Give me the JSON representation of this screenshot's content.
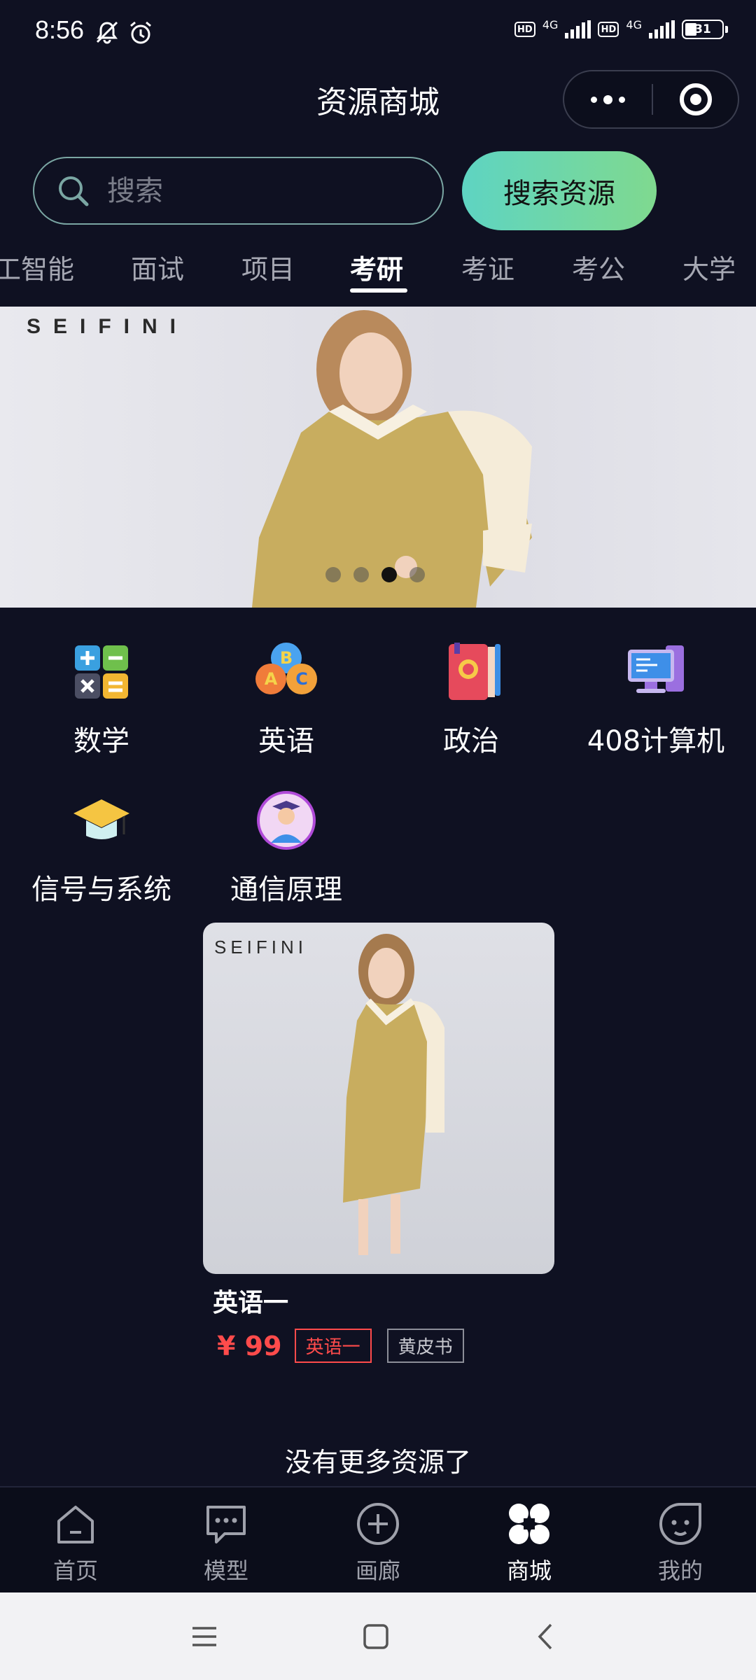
{
  "status_bar": {
    "time": "8:56",
    "network_1": "4G",
    "network_2": "4G",
    "hd_label": "HD",
    "battery": "31"
  },
  "header": {
    "title": "资源商城"
  },
  "search": {
    "placeholder": "搜索",
    "button_label": "搜索资源"
  },
  "tabs": [
    {
      "label": "工智能"
    },
    {
      "label": "面试"
    },
    {
      "label": "项目"
    },
    {
      "label": "考研",
      "active": true
    },
    {
      "label": "考证"
    },
    {
      "label": "考公"
    },
    {
      "label": "大学"
    }
  ],
  "banner": {
    "brand": "SEIFINI",
    "slide_count": 4,
    "active_slide": 3
  },
  "subjects": [
    {
      "label": "数学",
      "icon": "calculator-icon"
    },
    {
      "label": "英语",
      "icon": "abc-balloons-icon"
    },
    {
      "label": "政治",
      "icon": "red-book-icon"
    },
    {
      "label": "408计算机",
      "icon": "computer-icon"
    },
    {
      "label": "信号与系统",
      "icon": "graduation-cap-icon"
    },
    {
      "label": "通信原理",
      "icon": "student-avatar-icon"
    }
  ],
  "products": [
    {
      "brand": "SEIFINI",
      "name": "英语一",
      "price": "¥ 99",
      "tags": [
        "英语一",
        "黄皮书"
      ]
    }
  ],
  "list_end_text": "没有更多资源了",
  "bottom_nav": [
    {
      "label": "首页",
      "icon": "home-icon"
    },
    {
      "label": "模型",
      "icon": "chat-icon"
    },
    {
      "label": "画廊",
      "icon": "plus-circle-icon"
    },
    {
      "label": "商城",
      "icon": "grid-icon",
      "active": true
    },
    {
      "label": "我的",
      "icon": "face-icon"
    }
  ],
  "colors": {
    "background": "#0f1122",
    "accent_gradient_start": "#5ed4c2",
    "accent_gradient_end": "#7fd98f",
    "price": "#ff4b4b"
  }
}
